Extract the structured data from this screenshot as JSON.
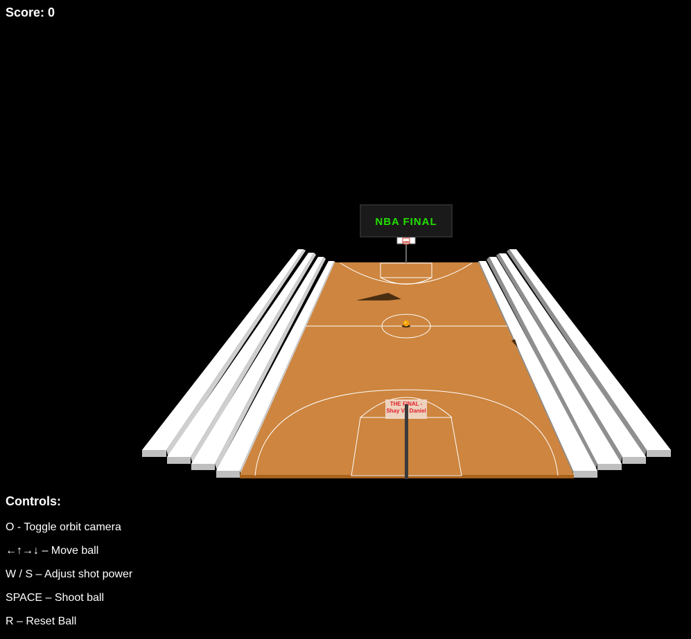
{
  "hud": {
    "score_label": "Score: 0"
  },
  "scoreboard": {
    "text": "NBA FINAL",
    "text_color": "#22e000"
  },
  "banner": {
    "line1": "THE FINAL -",
    "line2": "Shay Vs Daniel",
    "text_color": "#e0202a"
  },
  "controls": {
    "title": "Controls:",
    "items": [
      "O - Toggle orbit camera",
      "←↑→↓ – Move ball",
      "W / S – Adjust shot power",
      "SPACE – Shoot ball",
      "R – Reset Ball"
    ]
  },
  "colors": {
    "background": "#000000",
    "court": "#cd853f",
    "bleachers": "#ffffff",
    "bleacher_shade": "#bdbdbd",
    "ball": "#f5a000"
  }
}
